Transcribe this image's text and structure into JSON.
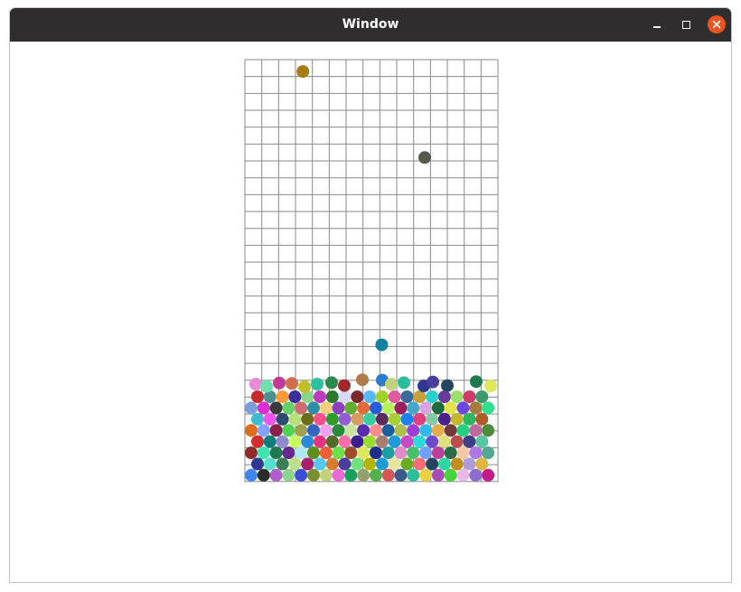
{
  "window": {
    "title": "Window",
    "controls": {
      "minimize": "minimize-icon",
      "maximize": "maximize-icon",
      "close": "close-icon",
      "close_color": "#e95420",
      "titlebar_color": "#2f2d2d"
    }
  },
  "board": {
    "columns": 15,
    "rows": 25,
    "grid_color": "#8a8a8a",
    "falling_balls": [
      {
        "col": 3.44,
        "row": 0.7,
        "color": "#a67c13"
      },
      {
        "col": 10.66,
        "row": 5.8,
        "color": "#545a4a"
      },
      {
        "col": 8.11,
        "row": 16.9,
        "color": "#12819e"
      }
    ],
    "pile_colors": [
      "#3f86ee",
      "#2b2b2b",
      "#b25ccf",
      "#8bd48b",
      "#3b4fd6",
      "#7a8f2e",
      "#c2d27a",
      "#e56ad6",
      "#17a05a",
      "#96a06c",
      "#55b04a",
      "#d75757",
      "#3c5b8c",
      "#2bbe9c",
      "#e9d241",
      "#a84cb5",
      "#48d43b",
      "#e9b8e4",
      "#8a6dcf",
      "#c41a8a",
      "#2d3a8f",
      "#56e0d0",
      "#3a7e57",
      "#bde08a",
      "#a6206e",
      "#53c9f2",
      "#d37e2c",
      "#4a3e9c",
      "#71e07f",
      "#b2b400",
      "#1f9bd4",
      "#e6e6a0",
      "#67ac22",
      "#fc6d78",
      "#234561",
      "#2fd6a4",
      "#c58d1a",
      "#ad9bdd",
      "#e0b53e",
      "#8f2b2b",
      "#3ee3b2",
      "#1d7a4f",
      "#64298f",
      "#b0e8f0",
      "#5c8f1e",
      "#f25c36",
      "#6be048",
      "#9f4c2a",
      "#dfe85b",
      "#1f2d8c",
      "#18a0a0",
      "#e08bc8",
      "#46c16a",
      "#70a0ff",
      "#bd3d9c",
      "#2a6d46",
      "#f7c8a4",
      "#ad78e6",
      "#54a890",
      "#d32e2e",
      "#127d7d",
      "#8e8ccf",
      "#c7ff62",
      "#2c8adb",
      "#e7327f",
      "#536b29",
      "#ff6ea6",
      "#3b1f8f",
      "#97dc2f",
      "#a87c6e",
      "#1e9bd8",
      "#c64ac4",
      "#2bd9d9",
      "#6b4acf",
      "#e0e07a",
      "#bc4b4b",
      "#3d3d8a",
      "#57c6a3",
      "#de6e1e",
      "#83a2ff",
      "#8a1f4c",
      "#4fd24f",
      "#a0a04d",
      "#3264c2",
      "#f1a0f1",
      "#278a3c",
      "#c9e3a1",
      "#5a2db0",
      "#ff8c8c",
      "#1c5e9e",
      "#adc24b",
      "#9d3dd6",
      "#32b8e8",
      "#e6ac4a",
      "#713a3a",
      "#21d17f",
      "#c06a9b",
      "#4b8c3a",
      "#3fbbd0",
      "#ef54ef",
      "#2e4a6e",
      "#b5e07a",
      "#6c6c19",
      "#ff4f8a",
      "#2a9d2a",
      "#905dd4",
      "#d89b60",
      "#37cfa1",
      "#5b2b5b",
      "#a8cf37",
      "#1c7ff2",
      "#e1407c",
      "#86c9a8",
      "#4c1e8a",
      "#c2b82e",
      "#2ab85e",
      "#b05a26",
      "#7a9fdc",
      "#dc2ed2",
      "#3a3a3a",
      "#63d163",
      "#cf6b6b",
      "#2d8fa6",
      "#f0d078",
      "#8b3fbf",
      "#5fae2f",
      "#e56a3a",
      "#2a5bd7",
      "#b6f25a",
      "#9c1e5a",
      "#46a6c9",
      "#d7a3e0",
      "#1d6b3b",
      "#e3e34a",
      "#6d48e0",
      "#a37d3d",
      "#2fe08e",
      "#c72a2a",
      "#4f8f8f",
      "#ff9a3a",
      "#3a2f9a",
      "#8ad68a",
      "#be3bbe",
      "#2b7a2b",
      "#d8d8ff",
      "#7a2a2a",
      "#58b8ff",
      "#a0d02a",
      "#e05aa0",
      "#3a6a9a",
      "#c8a03a",
      "#2ad0d0",
      "#6a3a9a",
      "#9ae06a",
      "#d03a6a",
      "#3a9a6a",
      "#ea8ad8",
      "#4a4a1a",
      "#1aa0ea",
      "#b07ad0",
      "#5a8a2a",
      "#e0703a",
      "#2a4ad0",
      "#70e0b0",
      "#a02ab0",
      "#d0d05a",
      "#2a6a6a",
      "#ff6a5a",
      "#4ab04a",
      "#7a7ae0",
      "#c03a9a",
      "#3ac03a",
      "#9a5a2a",
      "#2a9ad0",
      "#e0a0a0",
      "#6ab02a",
      "#3a3ab0",
      "#d0704a",
      "#5ad0a0",
      "#8a2a6a",
      "#b0d07a",
      "#2a5a2a",
      "#e05ae0",
      "#4a8ad0",
      "#c0c02a",
      "#7a3ad0",
      "#2ab07a",
      "#f05a5a",
      "#3a7a3a",
      "#a0a0e0",
      "#d05a2a",
      "#2ac0a0",
      "#5a2a9a",
      "#90e05a",
      "#c02a5a",
      "#3aa0a0",
      "#e0c05a",
      "#6a6ad0",
      "#2a8a4a",
      "#b04ab0",
      "#4ae04a",
      "#8a4a2a",
      "#2a6ab0",
      "#e08a5a",
      "#5ab0d0",
      "#a02a2a",
      "#3ad07a",
      "#d0a0d0",
      "#4a4ab0",
      "#7ab02a",
      "#e02a8a",
      "#2a9a5a",
      "#b07a4a",
      "#5a5ae0",
      "#30c0f0",
      "#c05a30",
      "#6ae06a",
      "#4a2a7a",
      "#d0d0a0",
      "#2a7ad0"
    ]
  }
}
